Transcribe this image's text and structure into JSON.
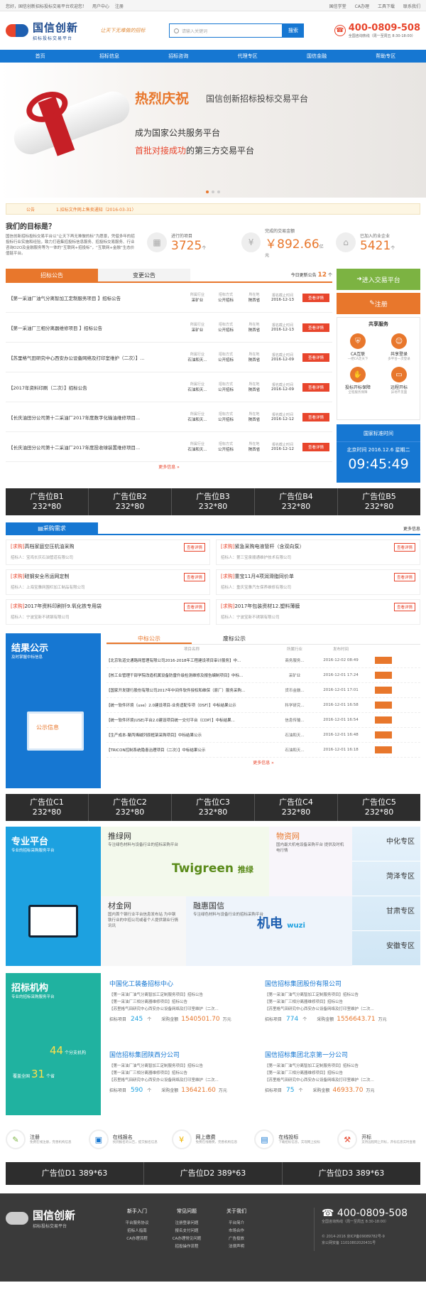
{
  "topbar": {
    "welcome": "您好，国信创新招标投标交易平台欢迎您！",
    "user_center": "用户中心",
    "register": "注册",
    "links": [
      "国信学堂",
      "CA办理",
      "工具下载",
      "联系我们"
    ]
  },
  "header": {
    "logo_cn": "国信创新",
    "logo_sub": "招标投标交易平台",
    "slogan": "让天下无难做的招标",
    "search_placeholder": "请输入关键词",
    "search_btn": "搜索",
    "hotline": "400-0809-508",
    "hotline_time": "全国咨询热线（周一至周五 8:30-18:00）"
  },
  "nav": [
    "首页",
    "招标信息",
    "招标咨询",
    "代理专区",
    "国信金融",
    "帮助专区"
  ],
  "banner": {
    "h1": "热烈庆祝",
    "h1b": "国信创新招标投标交易平台",
    "h2": "成为国家公共服务平台",
    "h3a": "首批对接成功",
    "h3b": "的第三方交易平台"
  },
  "notice": {
    "label": "公告",
    "text": "1.招标文件网上售卖通知（2016-03-31）"
  },
  "target": {
    "title": "我们的目标是？",
    "desc": "国信创新招标投标交易平台以“让天下再无难做的标”为愿景，凭借多年的招投标行业实施和经验，致力打造集招投标信息服务、招投标交易服务、行业咨询O2O及金融服务等为一体的“互联网+招投标”，“互联网+金融”生态价值链平台。"
  },
  "stats": [
    {
      "label": "进行的项目",
      "value": "3725",
      "unit": "个"
    },
    {
      "label": "完成的交易金额",
      "value": "￥892.66",
      "unit": "亿元"
    },
    {
      "label": "已加入的业企业",
      "value": "5421",
      "unit": "个"
    }
  ],
  "tenders": {
    "tab1": "招标公告",
    "tab2": "变更公告",
    "today_label": "今日更新公告",
    "today_count": "12",
    "today_unit": "个",
    "col_heads": [
      "所属行业",
      "招标方式",
      "所在地",
      "报名截止时间"
    ],
    "btn": "查看详情",
    "more": "更多信息 »",
    "rows": [
      {
        "title": "【第一采油厂油气分离智加工定制服务项目 】招标公告",
        "industry": "采矿业",
        "method": "公开招标",
        "area": "陕西省",
        "date": "2016-12-13"
      },
      {
        "title": "【第一采油厂三相分离器维修项目 】招标公告",
        "industry": "采矿业",
        "method": "公开招标",
        "area": "陕西省",
        "date": "2016-12-13"
      },
      {
        "title": "【苏里格气田研究中心西安办公设备网络及打印室维护（二次）】...",
        "industry": "石油和天...",
        "method": "公开招标",
        "area": "陕西省",
        "date": "2016-12-09"
      },
      {
        "title": "【2017年资料印刷（二次）】招标公告",
        "industry": "石油和天...",
        "method": "公开招标",
        "area": "陕西省",
        "date": "2016-12-09"
      },
      {
        "title": "【长庆油田分公司第十二采油厂2017年度数字化输油维修项目...",
        "industry": "石油和天...",
        "method": "公开招标",
        "area": "陕西省",
        "date": "2016-12-12"
      },
      {
        "title": "【长庆油田分公司第十二采油厂2017年度投收球装置维修项目...",
        "industry": "石油和天...",
        "method": "公开招标",
        "area": "陕西省",
        "date": "2016-12-12"
      }
    ]
  },
  "side": {
    "enter": "进入交易平台",
    "register": "注册",
    "share_title": "共享服务",
    "services": [
      {
        "name": "CA互联",
        "sub": "一把CA走天下"
      },
      {
        "name": "共享登录",
        "sub": "多平台一次登录"
      },
      {
        "name": "投标开标保障",
        "sub": "全程服务保障"
      },
      {
        "name": "远程开标",
        "sub": "异地不见面"
      }
    ],
    "clock_title": "国家标准时间",
    "clock_date": "北京时间 2016.12.6 星期二",
    "clock_time": "09:45:49"
  },
  "ads_b": [
    {
      "name": "广告位B1",
      "size": "232*80"
    },
    {
      "name": "广告位B2",
      "size": "232*80"
    },
    {
      "name": "广告位B3",
      "size": "232*80"
    },
    {
      "name": "广告位B4",
      "size": "232*80"
    },
    {
      "name": "广告位B5",
      "size": "232*80"
    }
  ],
  "purchase": {
    "title": "采购需求",
    "more": "更多信息",
    "btn": "查看详情",
    "items": [
      {
        "tag": "[求购]",
        "name": "高档家庭空压机油采购",
        "by": "招标人：宝鸡长庆石油管道有限公司"
      },
      {
        "tag": "[求购]",
        "name": "紧急采购电液管杆（含双向泵）",
        "by": "招标人：第三宝泉顺通维护技术有限公司"
      },
      {
        "tag": "[求购]",
        "name": "硅钢安全吊运网定制",
        "by": "招标人：上海宝雅网围栏加工制品有限公司"
      },
      {
        "tag": "[求购]",
        "name": "重宝11月4项润滑脂同价单",
        "by": "招标人：重庆宝雅汽车保养维修有限公司"
      },
      {
        "tag": "[求购]",
        "name": "2017年资料印刷钎9.氧化铁专用袋",
        "by": "招标人：宁波宝新不锈钢有限公司"
      },
      {
        "tag": "[求购]",
        "name": "2017年包装资材12.塑料薄膜",
        "by": "招标人：宁波宝新不锈钢有限公司"
      }
    ]
  },
  "result": {
    "title": "结果公示",
    "sub": "及时掌握中标信息",
    "screen": "公示信息",
    "tab1": "中标公示",
    "tab2": "废标公示",
    "heads": [
      "项目名称",
      "所属行业",
      "发布时间"
    ],
    "more": "更多信息 »",
    "rows": [
      {
        "name": "【北京轨道交通路网管理有限公司2016-2018年工程建设项目审计服务】中...",
        "ind": "商务服务...",
        "date": "2016-12-02 08:49"
      },
      {
        "name": "【核工业管理干部学院改造机属设备防雷升级检测维修及报告编制项目】中标...",
        "ind": "采矿业",
        "date": "2016-12-01 17:24"
      },
      {
        "name": "【国家开发银行股份有限公司2017年中间件软件授权和维保（原厂）服务采购...",
        "ind": "货币金融...",
        "date": "2016-12-01 17:01"
      },
      {
        "name": "【统一软件环境（use）2.0建设项目-业务适配专项（DSF）】中标结果公示",
        "ind": "科学研究...",
        "date": "2016-12-01 16:58"
      },
      {
        "name": "【统一软件环境(USE)平台2.0建设项目统一交付平台（CDP）】中标结果...",
        "ind": "信息传输...",
        "date": "2016-12-01 16:54"
      },
      {
        "name": "【生产成本-聚丙烯碱列原框架采购项目】中标结果公示",
        "ind": "石油和天...",
        "date": "2016-12-01 16:48"
      },
      {
        "name": "【TRICON控制系统隐患治理项目（二次）】中标结果公示",
        "ind": "石油和天...",
        "date": "2016-12-01 16:18"
      }
    ]
  },
  "ads_c": [
    {
      "name": "广告位C1",
      "size": "232*80"
    },
    {
      "name": "广告位C2",
      "size": "232*80"
    },
    {
      "name": "广告位C3",
      "size": "232*80"
    },
    {
      "name": "广告位C4",
      "size": "232*80"
    },
    {
      "name": "广告位C5",
      "size": "232*80"
    }
  ],
  "platform": {
    "title": "专业平台",
    "sub": "专业的招标采购服务平台",
    "cells": [
      {
        "name": "推绿网",
        "desc": "专注绿色材料与设备行业的招标采购平台"
      },
      {
        "name": "物资网",
        "desc": "国内最大机电设备采购平台 提供及时机电行情"
      },
      {
        "name": "材金网",
        "desc": "国内首个钢行业平台信息发布站 为中钢铁行业的中招公司或者个人提供钢业行情讯讯"
      },
      {
        "name": "融惠国信",
        "desc": "专注绿色材料与设备行业的招标采购平台"
      }
    ],
    "twigreen": "Twigreen",
    "twigreen_cn": "推绿",
    "jidian": "机电",
    "wuzi": "wuzi",
    "zones": [
      "中化专区",
      "菏泽专区",
      "甘肃专区",
      "安徽专区"
    ]
  },
  "agency": {
    "title": "招标机构",
    "sub": "专业的招标采购服务平台",
    "n1": "44",
    "n1u": "个分支机构",
    "n2": "31",
    "n2pre": "覆盖全国",
    "n2u": "个省",
    "list_lines": [
      "【第一采油厂油气分离智加工定制服务项目】招标公告",
      "【第一采油厂三相分离器维修项目】招标公告",
      "【苏里格气田研究中心西安办公设备网络及打印室维护（二次..."
    ],
    "label_proj": "招标项目",
    "label_amt": "采购金额",
    "unit_proj": "个",
    "unit_amt": "万元",
    "orgs": [
      {
        "name": "中国化工装备招标中心",
        "proj": "245",
        "amt": "1540501.70"
      },
      {
        "name": "国信招标集团股份有限公司",
        "proj": "774",
        "amt": "1556643.71"
      },
      {
        "name": "国信招标集团陕西分公司",
        "proj": "590",
        "amt": "136421.60"
      },
      {
        "name": "国信招标集团北京第一分公司",
        "proj": "75",
        "amt": "46933.70"
      }
    ]
  },
  "steps": [
    {
      "name": "注册",
      "sub": "免费在线注册，完善机构信息"
    },
    {
      "name": "在线报名",
      "sub": "找到报名的公告，提交报名信息"
    },
    {
      "name": "网上缴费",
      "sub": "免费在线缴费，完善机构信息"
    },
    {
      "name": "在线投标",
      "sub": "下载招标信息，实现网上投标"
    },
    {
      "name": "开标",
      "sub": "支持远程网上开标，开标信息实时查看"
    }
  ],
  "ads_d": [
    "广告位D1 389*63",
    "广告位D2 389*63",
    "广告位D3 389*63"
  ],
  "footer": {
    "logo_cn": "国信创新",
    "logo_sub": "招标投标交易平台",
    "cols": [
      {
        "title": "新手入门",
        "items": [
          "平台服务协议",
          "招标人指南",
          "CA办理流程"
        ]
      },
      {
        "title": "常见问题",
        "items": [
          "注册登录问题",
          "报名支付问题",
          "CA办理常见问题",
          "招投操作流程"
        ]
      },
      {
        "title": "关于我们",
        "items": [
          "平台简介",
          "市场合作",
          "广告投放",
          "法律声明"
        ]
      }
    ],
    "hotline": "400-0809-508",
    "hotline_time": "全国咨询热线（周一至周五 8:30-18:00）",
    "copyright": "© 2014-2016 京ICP备09089782号-9",
    "beian": "京公网安备 11010802020431号"
  }
}
